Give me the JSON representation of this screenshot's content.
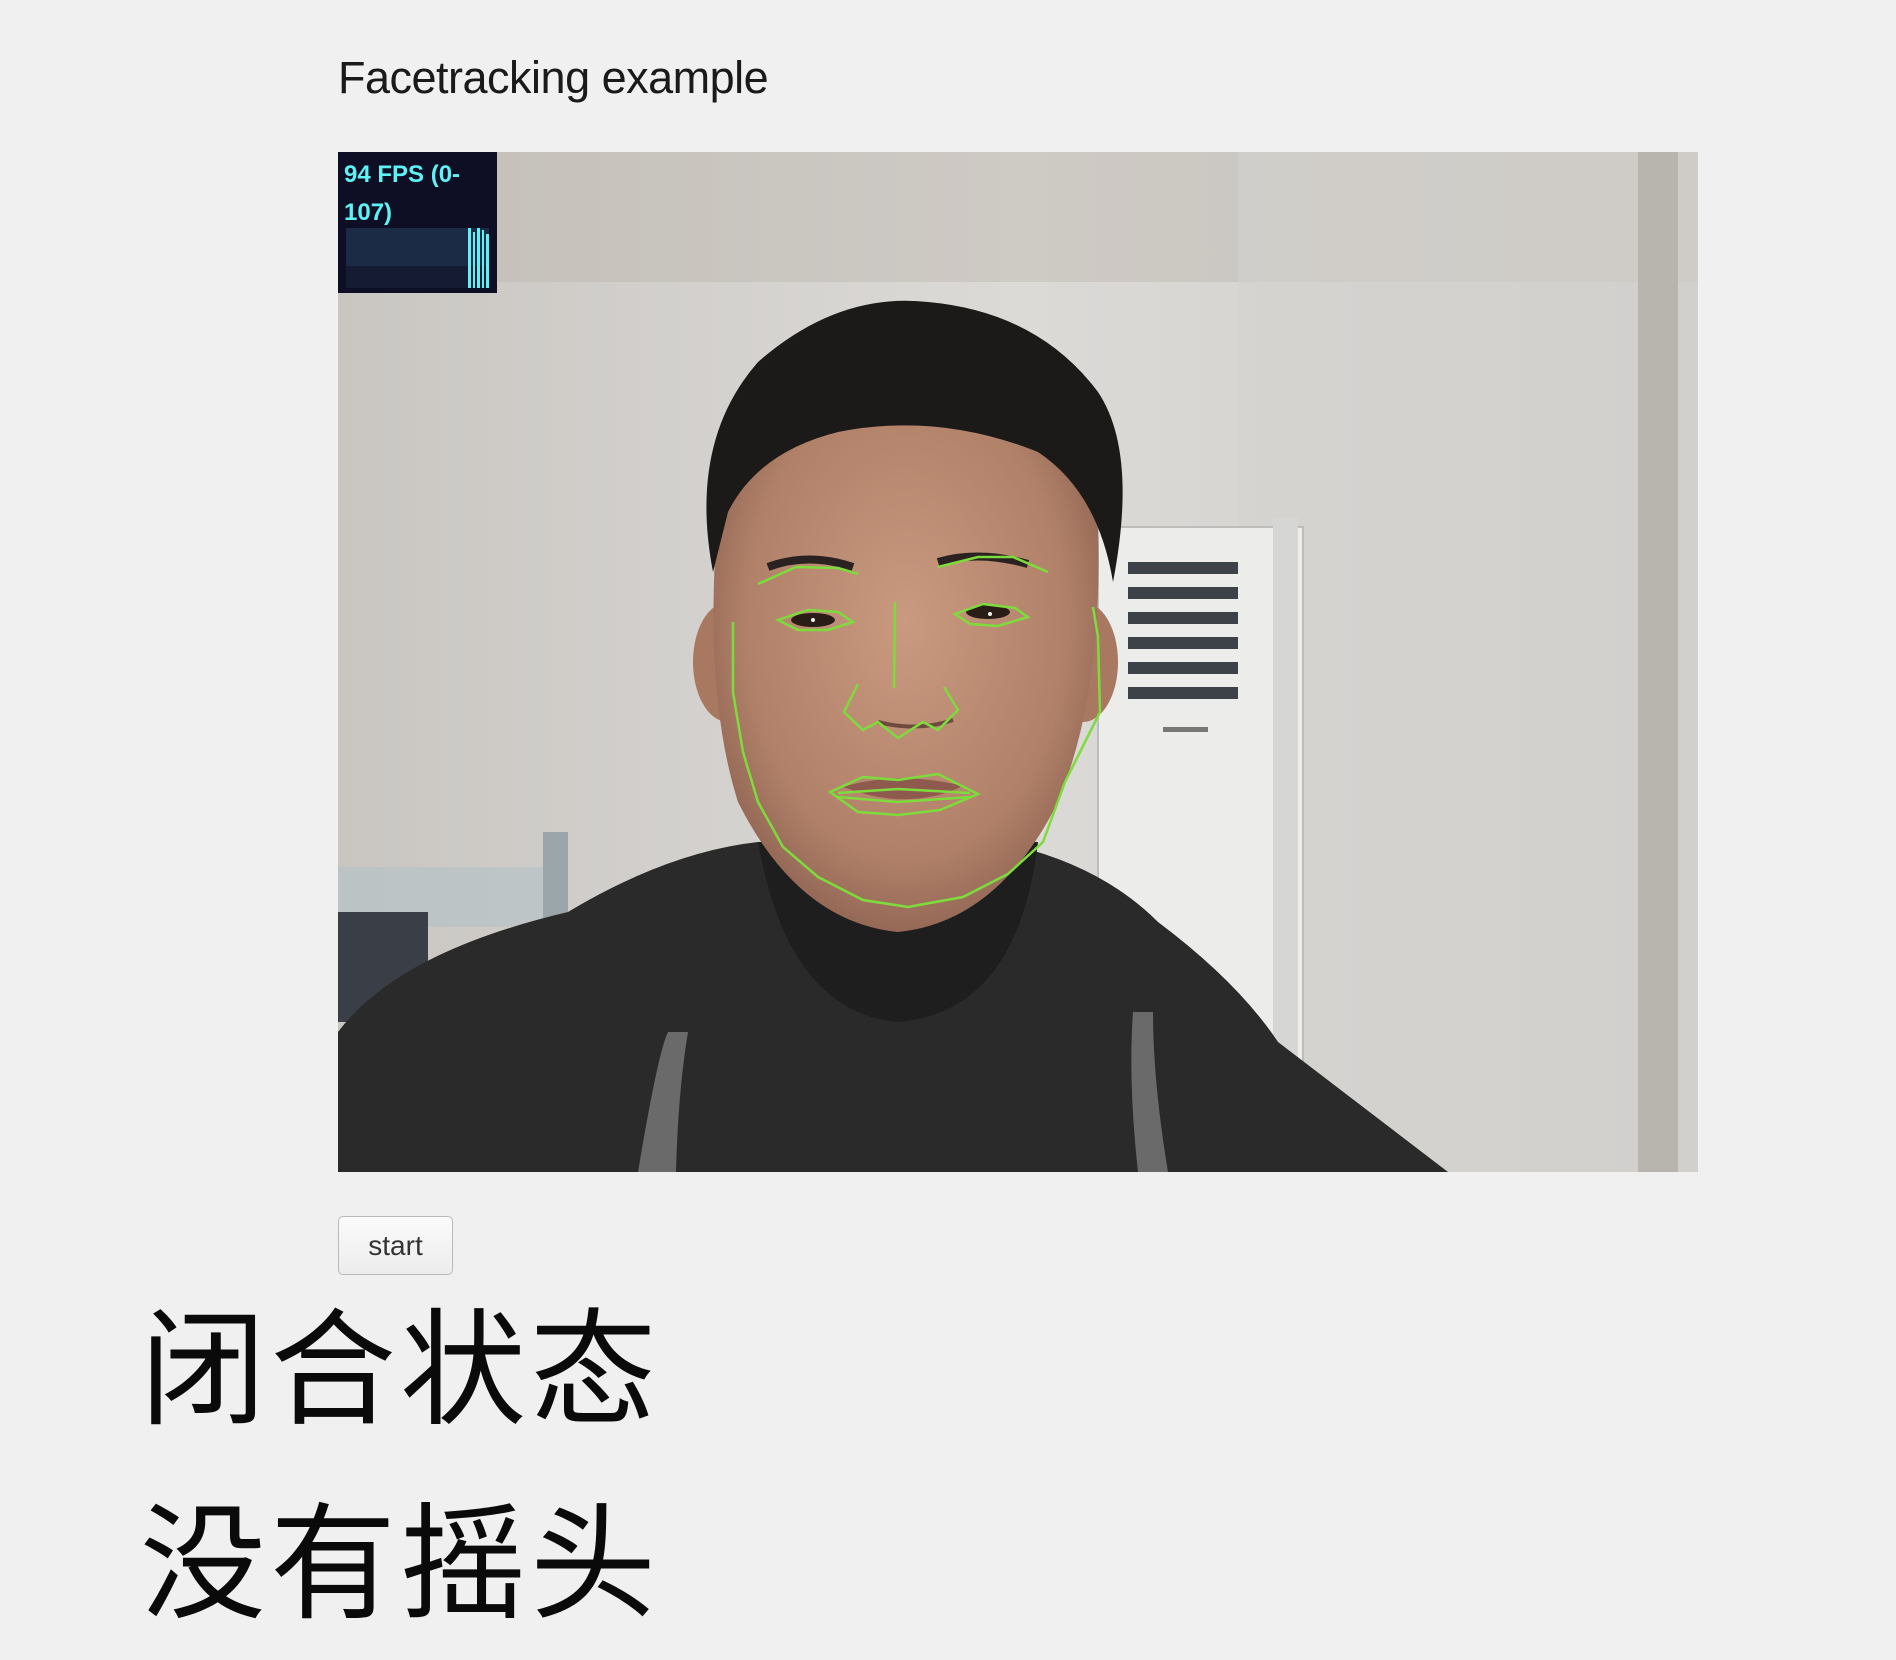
{
  "page": {
    "title": "Facetracking example"
  },
  "video": {
    "fps_label": "94 FPS (0-107)",
    "overlay_color": "#7ddc3c"
  },
  "controls": {
    "start_label": "start"
  },
  "status": {
    "mouth_state": "闭合状态",
    "head_state": "没有摇头"
  }
}
